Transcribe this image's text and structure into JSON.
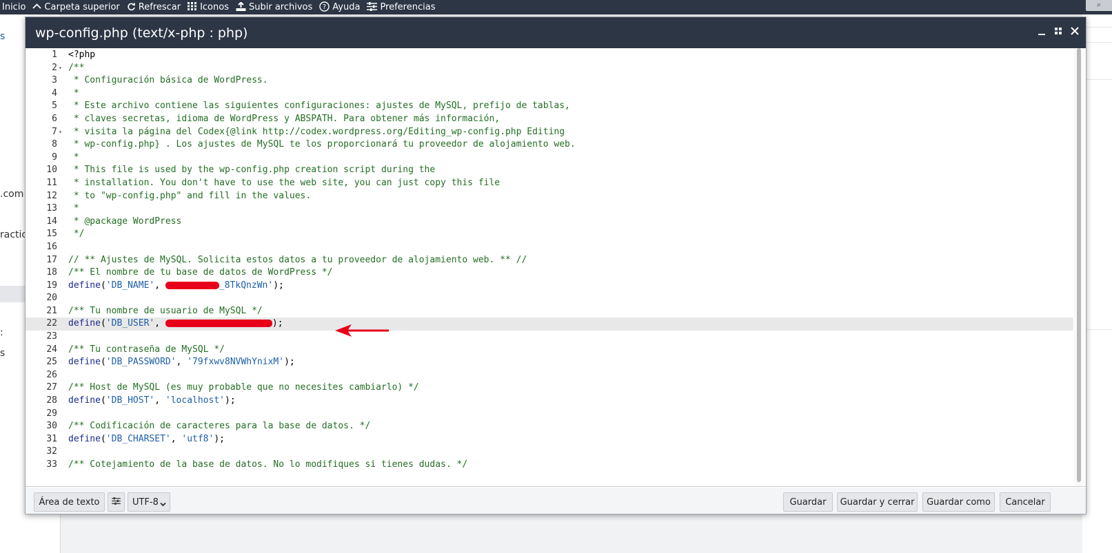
{
  "toolbar": {
    "items": [
      {
        "label": "Inicio",
        "icon": "home-icon"
      },
      {
        "label": "Carpeta superior",
        "icon": "chevron-up-icon"
      },
      {
        "label": "Refrescar",
        "icon": "refresh-icon"
      },
      {
        "label": "Iconos",
        "icon": "grid-icon"
      },
      {
        "label": "Subir archivos",
        "icon": "upload-icon"
      },
      {
        "label": "Ayuda",
        "icon": "help-icon"
      },
      {
        "label": "Preferencias",
        "icon": "sliders-icon"
      }
    ]
  },
  "background": {
    "left_fragments": [
      ".com",
      "ractic"
    ]
  },
  "dialog": {
    "title": "wp-config.php (text/x-php : php)",
    "controls": {
      "minimize": "minimize-icon",
      "maximize": "maximize-icon",
      "close": "close-icon"
    }
  },
  "editor": {
    "active_line": 22,
    "fold_lines": [
      2,
      7
    ],
    "lines": [
      {
        "n": "1",
        "text": "<?php"
      },
      {
        "n": "2",
        "text": "/**"
      },
      {
        "n": "3",
        "text": " * Configuración básica de WordPress."
      },
      {
        "n": "4",
        "text": " *"
      },
      {
        "n": "5",
        "text": " * Este archivo contiene las siguientes configuraciones: ajustes de MySQL, prefijo de tablas,"
      },
      {
        "n": "6",
        "text": " * claves secretas, idioma de WordPress y ABSPATH. Para obtener más información,"
      },
      {
        "n": "7",
        "text": " * visita la página del Codex{@link http://codex.wordpress.org/Editing_wp-config.php Editing"
      },
      {
        "n": "8",
        "text": " * wp-config.php} . Los ajustes de MySQL te los proporcionará tu proveedor de alojamiento web."
      },
      {
        "n": "9",
        "text": " *"
      },
      {
        "n": "10",
        "text": " * This file is used by the wp-config.php creation script during the"
      },
      {
        "n": "11",
        "text": " * installation. You don't have to use the web site, you can just copy this file"
      },
      {
        "n": "12",
        "text": " * to \"wp-config.php\" and fill in the values."
      },
      {
        "n": "13",
        "text": " *"
      },
      {
        "n": "14",
        "text": " * @package WordPress"
      },
      {
        "n": "15",
        "text": " */"
      },
      {
        "n": "16",
        "text": ""
      },
      {
        "n": "17",
        "text": "// ** Ajustes de MySQL. Solicita estos datos a tu proveedor de alojamiento web. ** //"
      },
      {
        "n": "18",
        "text": "/** El nombre de tu base de datos de WordPress */"
      },
      {
        "n": "19",
        "define_key": "'DB_NAME'",
        "define_val": "_8TkQnzWn'",
        "redacted": true
      },
      {
        "n": "20",
        "text": ""
      },
      {
        "n": "21",
        "text": "/** Tu nombre de usuario de MySQL */"
      },
      {
        "n": "22",
        "define_key": "'DB_USER'",
        "define_val": "",
        "redacted": true
      },
      {
        "n": "23",
        "text": ""
      },
      {
        "n": "24",
        "text": "/** Tu contraseña de MySQL */"
      },
      {
        "n": "25",
        "define_key": "'DB_PASSWORD'",
        "define_val": "'79fxwv8NVWhYnixM'"
      },
      {
        "n": "26",
        "text": ""
      },
      {
        "n": "27",
        "text": "/** Host de MySQL (es muy probable que no necesites cambiarlo) */"
      },
      {
        "n": "28",
        "define_key": "'DB_HOST'",
        "define_val": "'localhost'"
      },
      {
        "n": "29",
        "text": ""
      },
      {
        "n": "30",
        "text": "/** Codificación de caracteres para la base de datos. */"
      },
      {
        "n": "31",
        "define_key": "'DB_CHARSET'",
        "define_val": "'utf8'"
      },
      {
        "n": "32",
        "text": ""
      },
      {
        "n": "33",
        "text": "/** Cotejamiento de la base de datos. No lo modifiques si tienes dudas. */"
      }
    ]
  },
  "footer": {
    "textarea_button": "Área de texto",
    "settings_icon": "sliders-icon",
    "encoding_selected": "UTF-8",
    "save": "Guardar",
    "save_close": "Guardar y cerrar",
    "save_as": "Guardar como",
    "cancel": "Cancelar"
  },
  "colors": {
    "titlebar": "#2c3645",
    "comment": "#236e24",
    "keyword": "#1c2a8c",
    "string": "#1d5fa8",
    "annotation_red": "#e8001b"
  }
}
